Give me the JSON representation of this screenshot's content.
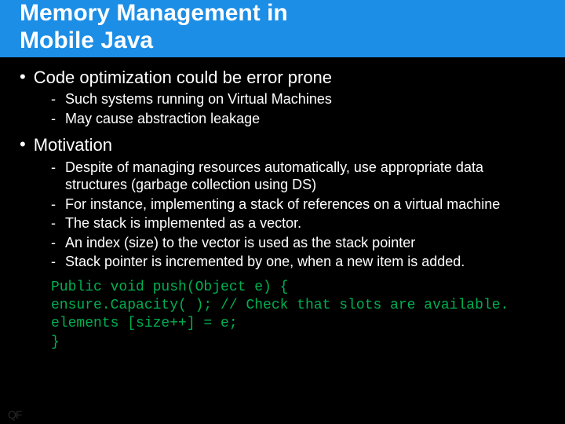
{
  "header": {
    "title_line1": "Memory Management in",
    "title_line2": "Mobile Java"
  },
  "sections": [
    {
      "heading": "Code optimization could be error prone",
      "items": [
        "Such systems running on Virtual Machines",
        "May cause abstraction leakage"
      ]
    },
    {
      "heading": "Motivation",
      "items": [
        "Despite of managing resources automatically, use appropriate data structures (garbage collection using DS)",
        "For instance, implementing a stack of references on a virtual machine",
        "The stack is implemented as a vector.",
        "An index (size) to the vector is used as the stack pointer",
        "Stack pointer is incremented by one, when a new item is added."
      ]
    }
  ],
  "code": [
    "Public void push(Object e) {",
    "ensure.Capacity( ); // Check that slots are available.",
    "elements [size++] = e;",
    "}"
  ],
  "watermark": "QF"
}
